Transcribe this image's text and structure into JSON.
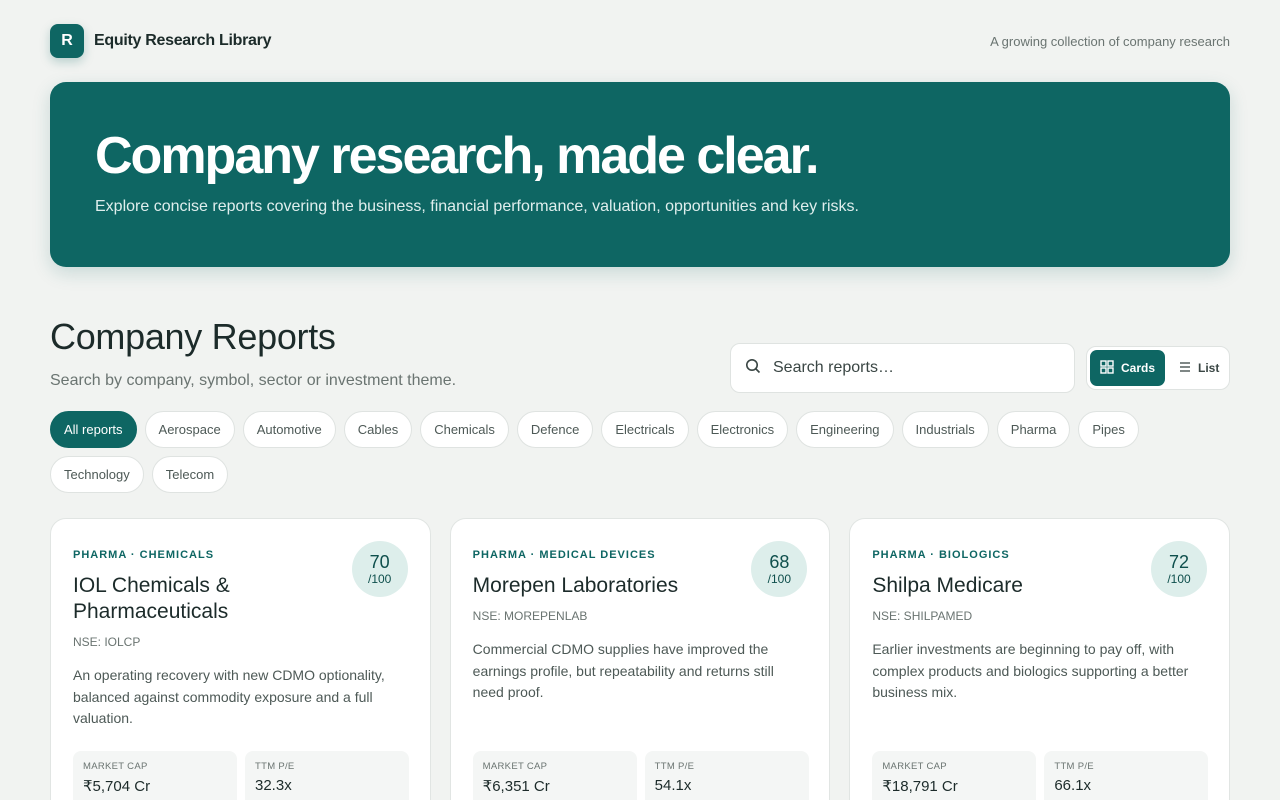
{
  "header": {
    "logo_letter": "R",
    "brand": "Equity Research Library",
    "tagline": "A growing collection of company research"
  },
  "hero": {
    "title": "Company research, made clear.",
    "subtitle": "Explore concise reports covering the business, financial performance, valuation, opportunities and key risks."
  },
  "section": {
    "title": "Company Reports",
    "subtitle": "Search by company, symbol, sector or investment theme."
  },
  "search": {
    "placeholder": "Search reports…",
    "value": "",
    "icon": "search-icon"
  },
  "view_toggle": {
    "cards_label": "Cards",
    "list_label": "List",
    "selected": "Cards"
  },
  "filters": [
    "All reports",
    "Aerospace",
    "Automotive",
    "Cables",
    "Chemicals",
    "Defence",
    "Electricals",
    "Electronics",
    "Engineering",
    "Industrials",
    "Pharma",
    "Pipes",
    "Technology",
    "Telecom"
  ],
  "active_filter": "All reports",
  "cards": [
    {
      "tag": "PHARMA · CHEMICALS",
      "company": "IOL Chemicals & Pharmaceuticals",
      "ticker": "NSE: IOLCP",
      "score": "70",
      "score_den": "/100",
      "description": "An operating recovery with new CDMO optionality, balanced against commodity exposure and a full valuation.",
      "metrics": [
        {
          "label": "MARKET CAP",
          "value": "₹5,704 Cr"
        },
        {
          "label": "TTM P/E",
          "value": "32.3x"
        }
      ]
    },
    {
      "tag": "PHARMA · MEDICAL DEVICES",
      "company": "Morepen Laboratories",
      "ticker": "NSE: MOREPENLAB",
      "score": "68",
      "score_den": "/100",
      "description": "Commercial CDMO supplies have improved the earnings profile, but repeatability and returns still need proof.",
      "metrics": [
        {
          "label": "MARKET CAP",
          "value": "₹6,351 Cr"
        },
        {
          "label": "TTM P/E",
          "value": "54.1x"
        }
      ]
    },
    {
      "tag": "PHARMA · BIOLOGICS",
      "company": "Shilpa Medicare",
      "ticker": "NSE: SHILPAMED",
      "score": "72",
      "score_den": "/100",
      "description": "Earlier investments are beginning to pay off, with complex products and biologics supporting a better business mix.",
      "metrics": [
        {
          "label": "MARKET CAP",
          "value": "₹18,791 Cr"
        },
        {
          "label": "TTM P/E",
          "value": "66.1x"
        }
      ]
    }
  ],
  "colors": {
    "accent": "#0e6663",
    "background": "#f1f3f1",
    "score_bg": "#ddeeeb"
  }
}
